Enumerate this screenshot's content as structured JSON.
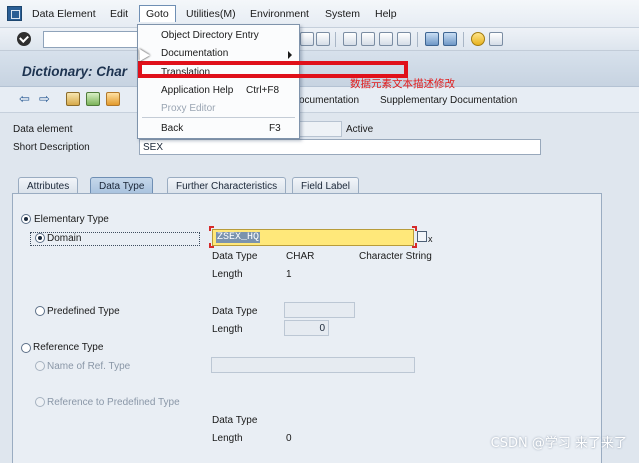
{
  "menubar": {
    "items": [
      "Data Element",
      "Edit",
      "Goto",
      "Utilities(M)",
      "Environment",
      "System",
      "Help"
    ]
  },
  "goto_menu": {
    "items": [
      {
        "label": "Object Directory Entry",
        "shortcut": ""
      },
      {
        "label": "Documentation",
        "shortcut": ""
      },
      {
        "label": "Translation",
        "shortcut": ""
      },
      {
        "label": "Application Help",
        "shortcut": "Ctrl+F8"
      },
      {
        "label": "Proxy Editor",
        "shortcut": ""
      },
      {
        "label": "Back",
        "shortcut": "F3"
      }
    ]
  },
  "title": "Dictionary: Char",
  "app_toolbar": {
    "documentation_label": "ocumentation",
    "supplementary_label": "Supplementary Documentation"
  },
  "header": {
    "data_element_label": "Data element",
    "status": "Active",
    "short_description_label": "Short Description",
    "short_description_value": "SEX"
  },
  "tabs": [
    "Attributes",
    "Data Type",
    "Further Characteristics",
    "Field Label"
  ],
  "selected_tab": "Data Type",
  "panel": {
    "elementary_type": "Elementary Type",
    "domain_label": "Domain",
    "domain_value": "ZSEX_HQ",
    "data_type_label": "Data Type",
    "data_type_value": "CHAR",
    "data_type_desc": "Character String",
    "length_label": "Length",
    "length_value": "1",
    "predefined_type": "Predefined Type",
    "predef_data_type_label": "Data Type",
    "predef_length_label": "Length",
    "predef_length_value": "0",
    "reference_type": "Reference Type",
    "name_of_ref_type": "Name of Ref. Type",
    "reference_to_predefined": "Reference to Predefined Type",
    "ref_data_type_label": "Data Type",
    "ref_length_label": "Length",
    "ref_length_value": "0"
  },
  "annotation": "数据元素文本描述修改",
  "watermark": "CSDN @学习 来了来了"
}
